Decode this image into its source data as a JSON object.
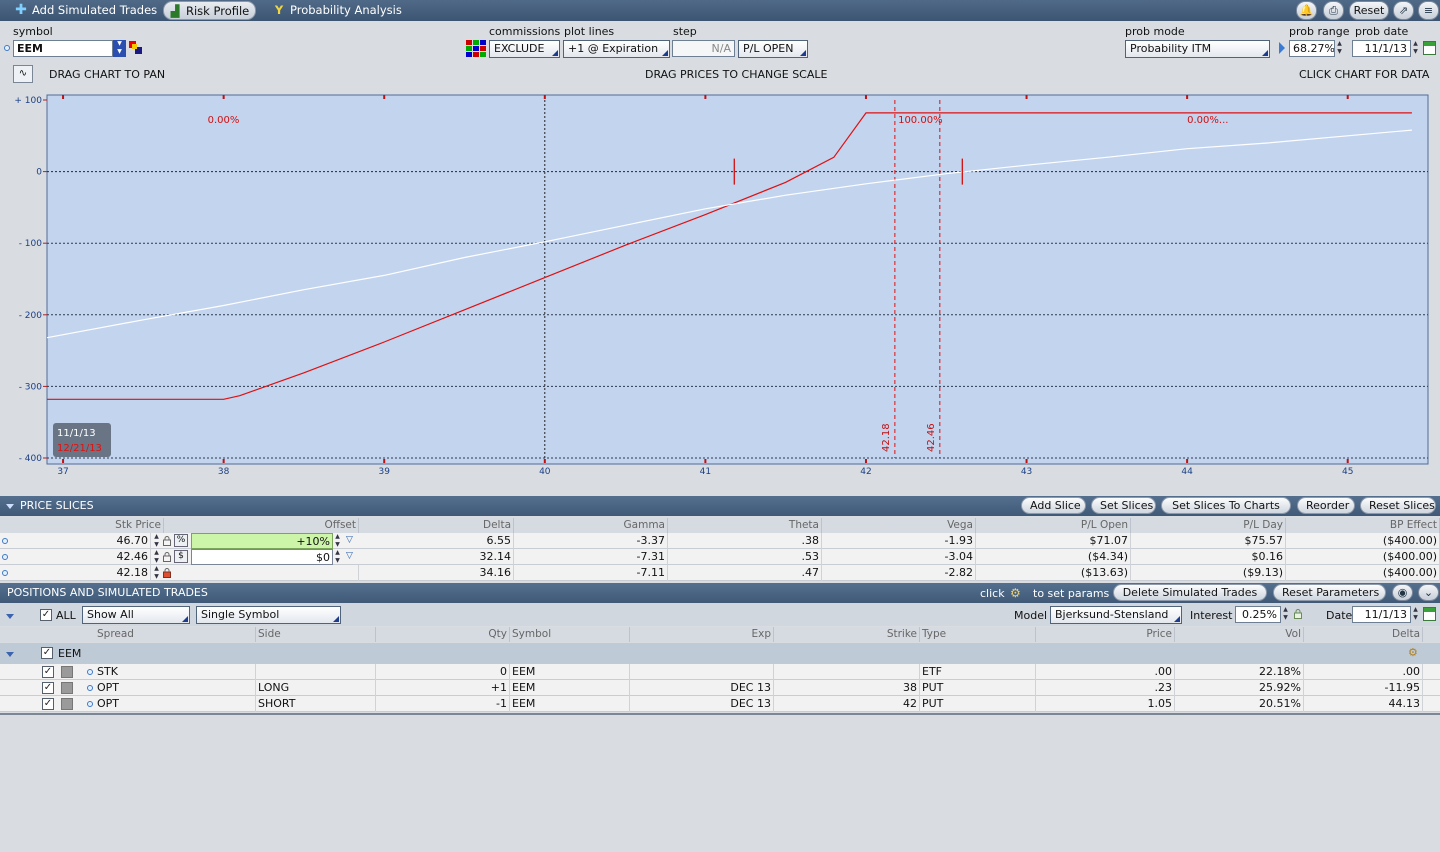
{
  "toolbar": {
    "add_trades": "Add Simulated Trades",
    "risk_profile": "Risk Profile",
    "probability": "Probability Analysis",
    "reset": "Reset"
  },
  "controls": {
    "symbol_label": "symbol",
    "symbol_value": "EEM",
    "commissions_label": "commissions",
    "commissions_value": "EXCLUDE",
    "plot_lines_label": "plot lines",
    "plot_lines_value": "+1 @ Expiration",
    "step_label": "step",
    "step_value": "N/A",
    "pl_mode_value": "P/L OPEN",
    "prob_mode_label": "prob mode",
    "prob_mode_value": "Probability ITM",
    "prob_range_label": "prob range",
    "prob_range_value": "68.27%",
    "prob_date_label": "prob date",
    "prob_date_value": "11/1/13"
  },
  "chart_hints": {
    "pan": "DRAG CHART TO PAN",
    "scale": "DRAG PRICES TO CHANGE SCALE",
    "click": "CLICK CHART FOR DATA"
  },
  "chart_data": {
    "type": "line",
    "xlim": [
      36.9,
      45.5
    ],
    "ylim": [
      -400,
      100
    ],
    "x_ticks": [
      "37",
      "38",
      "39",
      "40",
      "41",
      "42",
      "43",
      "44",
      "45"
    ],
    "y_ticks": [
      "+ 100",
      "0",
      "- 100",
      "- 200",
      "- 300",
      "- 400"
    ],
    "y_tick_values": [
      100,
      0,
      -100,
      -200,
      -300,
      -400
    ],
    "x_tick_values": [
      37,
      38,
      39,
      40,
      41,
      42,
      43,
      44,
      45
    ],
    "series": [
      {
        "name": "12/21/13",
        "color": "#e01010",
        "x": [
          36.9,
          37.5,
          38.0,
          38.1,
          38.5,
          39.0,
          39.5,
          40.0,
          40.5,
          41.0,
          41.5,
          41.8,
          42.0,
          45.4
        ],
        "y": [
          -318,
          -318,
          -318,
          -313,
          -281,
          -238,
          -193,
          -148,
          -103,
          -60,
          -15,
          20,
          82,
          82
        ]
      },
      {
        "name": "11/1/13",
        "color": "#ffffff",
        "x": [
          36.9,
          37.5,
          38.0,
          38.5,
          39.0,
          39.5,
          40.0,
          40.5,
          41.0,
          41.5,
          42.0,
          42.5,
          43.0,
          43.5,
          44.0,
          44.5,
          45.0,
          45.4
        ],
        "y": [
          -232,
          -207,
          -187,
          -165,
          -145,
          -120,
          -98,
          -75,
          -52,
          -33,
          -17,
          -3,
          9,
          20,
          32,
          40,
          50,
          58
        ]
      }
    ],
    "vertical_markers": [
      {
        "x": 40.0,
        "style": "dotted",
        "color": "#222222"
      },
      {
        "x": 42.18,
        "label": "42.18",
        "style": "dashed",
        "color": "#e01010"
      },
      {
        "x": 42.46,
        "label": "42.46",
        "style": "dashed",
        "color": "#e01010"
      }
    ],
    "breakeven_ticks": [
      41.18,
      42.6
    ],
    "prob_labels": [
      {
        "x": 37.9,
        "text": "0.00%"
      },
      {
        "x": 42.2,
        "text": "100.00%"
      },
      {
        "x": 44.0,
        "text": "0.00%..."
      }
    ],
    "legend": [
      "11/1/13",
      "12/21/13"
    ],
    "grid": true
  },
  "price_slices": {
    "title": "PRICE SLICES",
    "buttons": [
      "Add Slice",
      "Set Slices",
      "Set Slices To Charts",
      "Reorder",
      "Reset Slices"
    ],
    "headers": [
      "Stk Price",
      "Offset",
      "Delta",
      "Gamma",
      "Theta",
      "Vega",
      "P/L Open",
      "P/L Day",
      "BP Effect"
    ],
    "rows": [
      {
        "stk": "46.70",
        "unit": "%",
        "offset": "+10%",
        "delta": "6.55",
        "gamma": "-3.37",
        "theta": ".38",
        "vega": "-1.93",
        "pl_open": "$71.07",
        "pl_day": "$75.57",
        "bp": "($400.00)"
      },
      {
        "stk": "42.46",
        "unit": "$",
        "offset": "$0",
        "delta": "32.14",
        "gamma": "-7.31",
        "theta": ".53",
        "vega": "-3.04",
        "pl_open": "($4.34)",
        "pl_day": "$0.16",
        "bp": "($400.00)"
      },
      {
        "stk": "42.18",
        "unit": "",
        "offset": "",
        "delta": "34.16",
        "gamma": "-7.11",
        "theta": ".47",
        "vega": "-2.82",
        "pl_open": "($13.63)",
        "pl_day": "($9.13)",
        "bp": "($400.00)"
      }
    ]
  },
  "positions": {
    "title": "POSITIONS AND SIMULATED TRADES",
    "click_text": "click",
    "params_text": "to set params",
    "delete_btn": "Delete Simulated Trades",
    "reset_params_btn": "Reset Parameters",
    "all_label": "ALL",
    "show_value": "Show All",
    "symbol_filter": "Single Symbol",
    "model_label": "Model",
    "model_value": "Bjerksund-Stensland",
    "interest_label": "Interest",
    "interest_value": "0.25%",
    "date_label": "Date",
    "date_value": "11/1/13",
    "headers": [
      "Spread",
      "Side",
      "Qty",
      "Symbol",
      "Exp",
      "Strike",
      "Type",
      "Price",
      "Vol",
      "Delta"
    ],
    "group": "EEM",
    "rows": [
      {
        "spread": "STK",
        "side": "",
        "qty": "0",
        "symbol": "EEM",
        "exp": "",
        "strike": "",
        "type": "ETF",
        "price": ".00",
        "vol": "22.18%",
        "delta": ".00"
      },
      {
        "spread": "OPT",
        "side": "LONG",
        "qty": "+1",
        "symbol": "EEM",
        "exp": "DEC 13",
        "strike": "38",
        "type": "PUT",
        "price": ".23",
        "vol": "25.92%",
        "delta": "-11.95"
      },
      {
        "spread": "OPT",
        "side": "SHORT",
        "qty": "-1",
        "symbol": "EEM",
        "exp": "DEC 13",
        "strike": "42",
        "type": "PUT",
        "price": "1.05",
        "vol": "20.51%",
        "delta": "44.13"
      }
    ]
  }
}
